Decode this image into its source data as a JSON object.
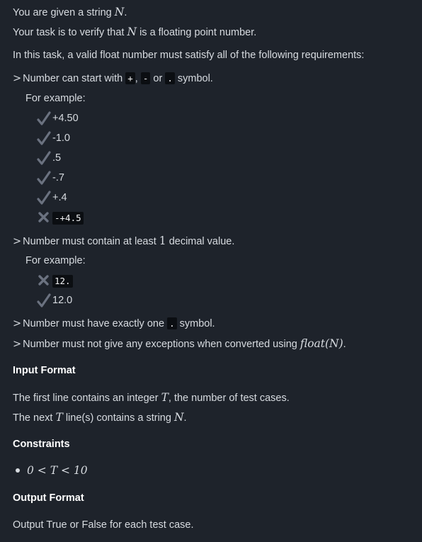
{
  "intro": {
    "given": "You are given a string",
    "given_var": "N",
    "given_end": ".",
    "task": "Your task is to verify that",
    "task_var": "N",
    "task_end": "is a floating point number.",
    "requirements": "In this task, a valid float number must satisfy all of the following requirements:"
  },
  "rule1": {
    "prefix": "Number can start with",
    "sym_plus": "+",
    "sep1": ",",
    "sym_minus": "-",
    "or": "or",
    "sym_dot": ".",
    "suffix": "symbol.",
    "for_example": "For example:",
    "examples": [
      {
        "text": "+4.50",
        "valid": true
      },
      {
        "text": "-1.0",
        "valid": true
      },
      {
        "text": ".5",
        "valid": true
      },
      {
        "text": "-.7",
        "valid": true
      },
      {
        "text": "+.4",
        "valid": true
      },
      {
        "text": "-+4.5",
        "valid": false
      }
    ]
  },
  "rule2": {
    "prefix": "Number must contain at least",
    "num": "1",
    "suffix": "decimal value.",
    "for_example": "For example:",
    "examples": [
      {
        "text": "12.",
        "valid": false
      },
      {
        "text": "12.0",
        "valid": true
      }
    ]
  },
  "rule3": {
    "prefix": "Number must have exactly one",
    "sym_dot": ".",
    "suffix": "symbol."
  },
  "rule4": {
    "prefix": "Number must not give any exceptions when converted using",
    "func": "float(N)",
    "end": "."
  },
  "input_format": {
    "heading": "Input Format",
    "line1_prefix": "The first line contains an integer",
    "line1_var": "T",
    "line1_suffix": ", the number of test cases.",
    "line2_prefix": "The next",
    "line2_var": "T",
    "line2_mid": "line(s) contains a string",
    "line2_var2": "N",
    "line2_end": "."
  },
  "constraints": {
    "heading": "Constraints",
    "expr": "0 < T < 10"
  },
  "output_format": {
    "heading": "Output Format",
    "text": "Output True or False for each test case."
  },
  "colors": {
    "background": "#1e232b",
    "text": "#d7dbe0",
    "check": "#6b7280",
    "cross": "#6b7280",
    "code_bg": "#0b0e12"
  }
}
